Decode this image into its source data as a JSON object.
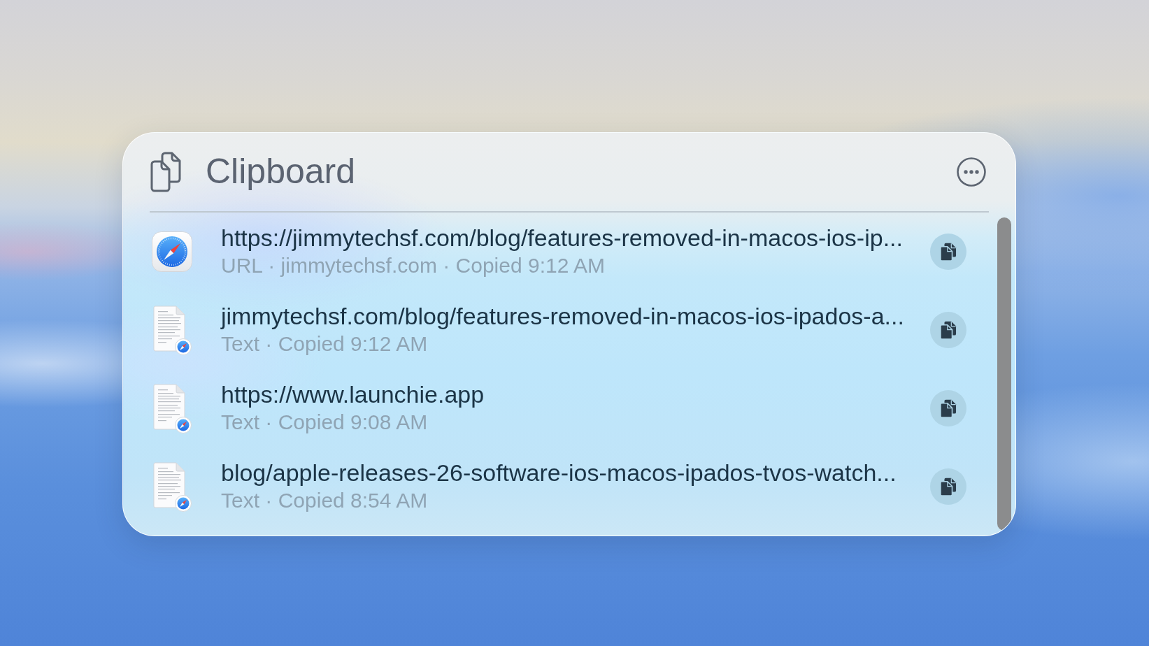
{
  "panel": {
    "title": "Clipboard"
  },
  "items": [
    {
      "kind": "url",
      "title": "https://jimmytechsf.com/blog/features-removed-in-macos-ios-ip...",
      "detail": "URL · jimmytechsf.com · Copied 9:12 AM"
    },
    {
      "kind": "text",
      "title": "jimmytechsf.com/blog/features-removed-in-macos-ios-ipados-a...",
      "detail": "Text · Copied 9:12 AM"
    },
    {
      "kind": "text",
      "title": "https://www.launchie.app",
      "detail": "Text · Copied 9:08 AM"
    },
    {
      "kind": "text",
      "title": "blog/apple-releases-26-software-ios-macos-ipados-tvos-watch...",
      "detail": "Text · Copied 8:54 AM"
    }
  ]
}
